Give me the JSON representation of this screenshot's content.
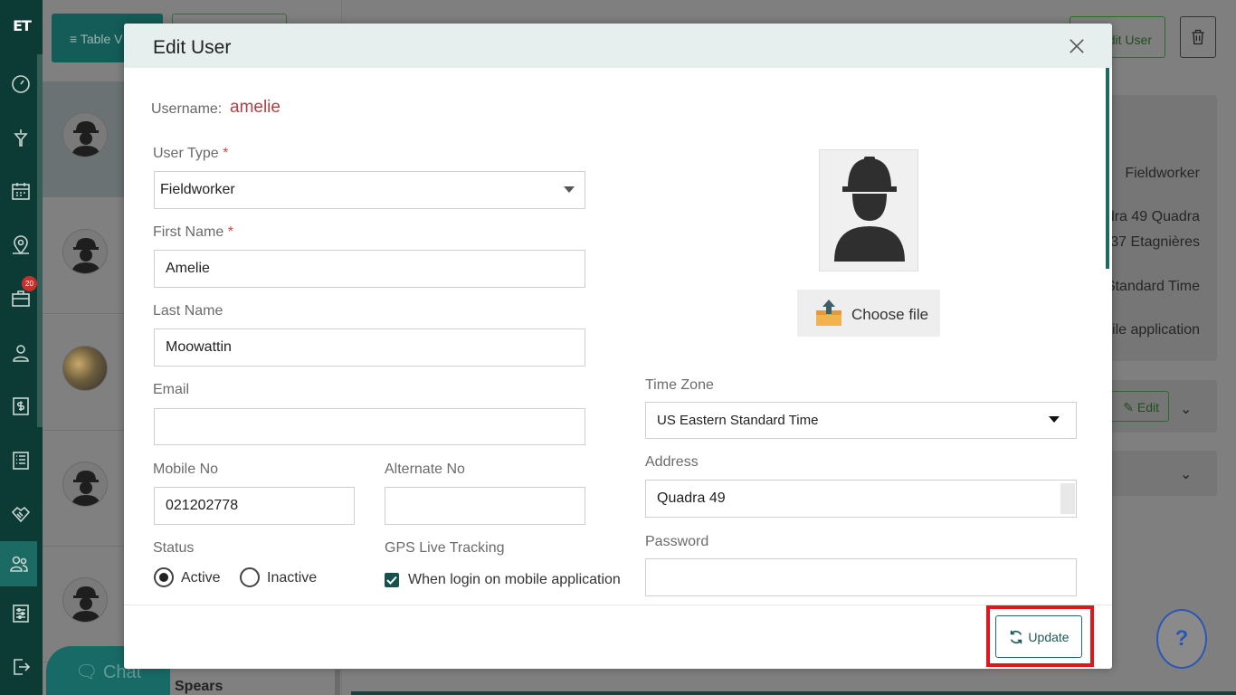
{
  "sidebar": {
    "logo": "ET",
    "badge": "20",
    "items": [
      {
        "name": "dashboard-icon"
      },
      {
        "name": "funnel-icon"
      },
      {
        "name": "calendar-icon"
      },
      {
        "name": "map-pin-icon"
      },
      {
        "name": "briefcase-icon"
      },
      {
        "name": "user-icon"
      },
      {
        "name": "dollar-icon"
      },
      {
        "name": "list-icon"
      },
      {
        "name": "handshake-icon"
      },
      {
        "name": "users-icon"
      },
      {
        "name": "sliders-icon"
      },
      {
        "name": "logout-icon"
      }
    ]
  },
  "background": {
    "table_view_label": "Table V",
    "edit_user_label": "Edit User",
    "user_type": "Fieldworker",
    "address_line1": "dra 49 Quadra",
    "address_line2": "037 Etagnières",
    "timezone": "Standard Time",
    "gps": "bile application",
    "edit_label": "Edit",
    "chat_label": "Chat",
    "partial_name": "Spears",
    "help_label": "?"
  },
  "modal": {
    "title": "Edit User",
    "username_label": "Username:",
    "username_value": "amelie",
    "user_type": {
      "label": "User Type",
      "required": "*",
      "value": "Fieldworker"
    },
    "first_name": {
      "label": "First Name",
      "required": "*",
      "value": "Amelie"
    },
    "last_name": {
      "label": "Last Name",
      "value": "Moowattin"
    },
    "email": {
      "label": "Email",
      "value": ""
    },
    "mobile": {
      "label": "Mobile No",
      "value": "021202778"
    },
    "alternate": {
      "label": "Alternate No",
      "value": ""
    },
    "status": {
      "label": "Status",
      "options": [
        "Active",
        "Inactive"
      ],
      "selected": "Active"
    },
    "gps": {
      "label": "GPS Live Tracking",
      "option": "When login on mobile application",
      "checked": true
    },
    "choose_file_label": "Choose file",
    "time_zone": {
      "label": "Time Zone",
      "value": "US Eastern Standard Time"
    },
    "address": {
      "label": "Address",
      "value": "Quadra 49"
    },
    "password": {
      "label": "Password",
      "value": ""
    },
    "update_label": "Update"
  },
  "colors": {
    "brand": "#0c3a34",
    "accent": "#1d6b64",
    "username": "#a94442",
    "highlight": "#e0161f"
  }
}
